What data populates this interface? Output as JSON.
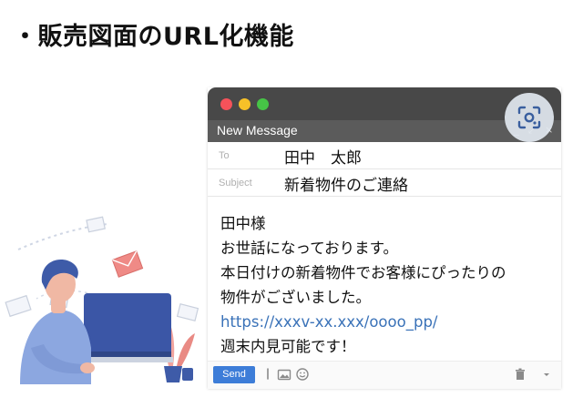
{
  "heading": {
    "text": "・販売図面のURL化機能"
  },
  "mail": {
    "window_title": "New Message",
    "window_controls": [
      "_",
      "⤢",
      "×"
    ],
    "to": {
      "label": "To",
      "value": "田中　太郎"
    },
    "subject": {
      "label": "Subject",
      "value": "新着物件のご連絡"
    },
    "body": {
      "line1": "田中様",
      "line2": "お世話になっております。",
      "line3": "本日付けの新着物件でお客様にぴったりの",
      "line4": "物件がございました。",
      "link": "https://xxxv-xx.xxx/oooo_pp/",
      "line6": "週末内見可能です！"
    },
    "send_label": "Send"
  },
  "colors": {
    "titlebar": "#484848",
    "message_bar": "#5b5b5b",
    "send_button": "#3d7dd8",
    "link": "#3a72b8",
    "light_red": "#f5525a",
    "light_yellow": "#f7c128",
    "light_green": "#46c446"
  },
  "icons": [
    "lens-scan-icon",
    "attach-icon",
    "image-icon",
    "emoji-icon",
    "trash-icon",
    "more-options-icon"
  ]
}
